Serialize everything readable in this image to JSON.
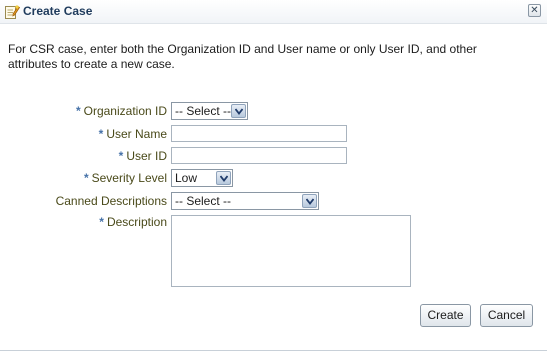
{
  "dialog": {
    "title": "Create Case",
    "icon": "edit-document-icon",
    "close_icon": "close-icon"
  },
  "instructions": "For CSR case, enter both the Organization ID and User name or only User ID, and other attributes to create a new case.",
  "required_marker": "*",
  "form": {
    "organization_id": {
      "label": "Organization ID",
      "value": "-- Select --",
      "required": true
    },
    "user_name": {
      "label": "User Name",
      "value": "",
      "required": true
    },
    "user_id": {
      "label": "User ID",
      "value": "",
      "required": true
    },
    "severity_level": {
      "label": "Severity Level",
      "value": "Low",
      "required": true
    },
    "canned_descriptions": {
      "label": "Canned Descriptions",
      "value": "-- Select --",
      "required": false
    },
    "description": {
      "label": "Description",
      "value": "",
      "required": true
    }
  },
  "buttons": {
    "create": "Create",
    "cancel": "Cancel"
  }
}
